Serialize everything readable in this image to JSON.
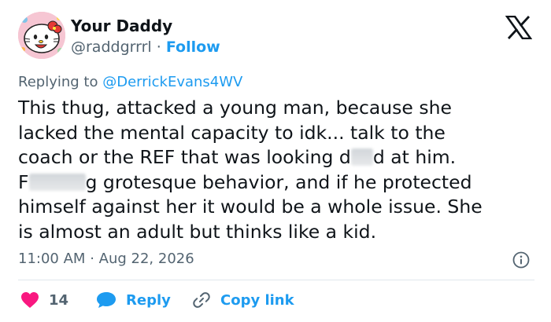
{
  "author": {
    "display_name": "Your Daddy",
    "handle": "@raddgrrrl",
    "separator": "·",
    "follow_label": "Follow"
  },
  "reply_context": {
    "prefix": "Replying to",
    "handle": "@DerrickEvans4WV"
  },
  "tweet": {
    "text_part1": "This thug, attacked a young man, because she\nlacked the mental capacity to idk... talk to the\ncoach or the REF that was looking d",
    "text_part2": "d at him.\nF",
    "text_part3": "g grotesque behavior, and if he protected\nhimself against her it would be a whole issue. She\nis almost an adult but thinks like a kid."
  },
  "meta": {
    "time": "11:00 AM",
    "separator": "·",
    "date": "Aug 22, 2026"
  },
  "actions": {
    "like_count": "14",
    "reply_label": "Reply",
    "copy_link_label": "Copy link"
  },
  "icons": {
    "platform_logo": "x-logo-icon",
    "info": "info-icon",
    "like": "heart-icon",
    "reply": "speech-bubble-icon",
    "copy": "link-icon"
  },
  "colors": {
    "accent": "#1d9bf0",
    "like": "#f91880",
    "secondary_text": "#536471",
    "primary_text": "#0f1419",
    "divider": "#e1e8ed"
  }
}
